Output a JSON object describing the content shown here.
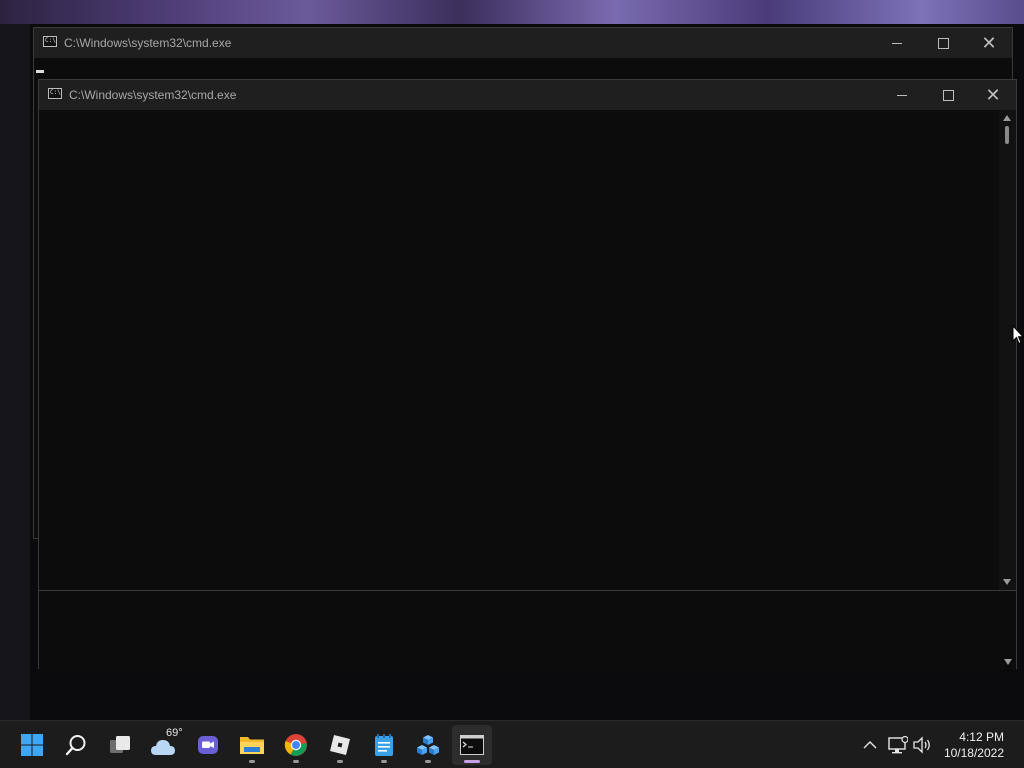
{
  "windows": {
    "back": {
      "title": "C:\\Windows\\system32\\cmd.exe",
      "icon_text": "C:\\",
      "controls": {
        "minimize": "minimize-icon",
        "maximize": "maximize-icon",
        "close": "close-icon",
        "close_glyph": "✕"
      }
    },
    "front": {
      "title": "C:\\Windows\\system32\\cmd.exe",
      "icon_text": "C:\\",
      "controls": {
        "minimize": "minimize-icon",
        "maximize": "maximize-icon",
        "close": "close-icon",
        "close_glyph": "✕"
      }
    }
  },
  "taskbar": {
    "apps": [
      {
        "name": "start",
        "icon": "windows-start-icon"
      },
      {
        "name": "search",
        "icon": "search-icon"
      },
      {
        "name": "task-view",
        "icon": "task-view-icon"
      },
      {
        "name": "weather",
        "icon": "weather-cloud-icon"
      },
      {
        "name": "chat",
        "icon": "chat-icon"
      },
      {
        "name": "file-explorer",
        "icon": "folder-icon"
      },
      {
        "name": "chrome",
        "icon": "chrome-icon"
      },
      {
        "name": "roblox",
        "icon": "roblox-icon"
      },
      {
        "name": "notepad",
        "icon": "notepad-icon"
      },
      {
        "name": "app-cubes",
        "icon": "cubes-icon"
      },
      {
        "name": "command-prompt",
        "icon": "terminal-icon"
      }
    ],
    "weather_temp": "69°",
    "tray": {
      "chevron": "^",
      "network_icon": "network-icon",
      "volume_icon": "volume-icon"
    },
    "clock": {
      "time": "4:12 PM",
      "date": "10/18/2022"
    }
  },
  "colors": {
    "console_bg": "#0c0c0c",
    "titlebar_bg": "#1f1f1f",
    "taskbar_bg": "#1c1c1c",
    "active_indicator": "#c6a0e6"
  }
}
